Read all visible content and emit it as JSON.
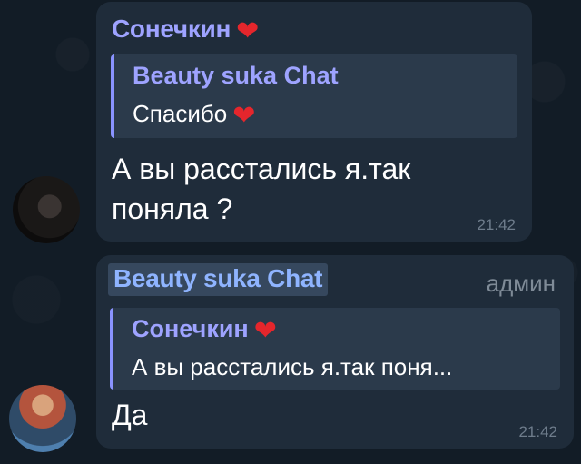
{
  "messages": [
    {
      "sender": "Сонечкин",
      "reply": {
        "author": "Beauty suka Chat",
        "text": "Спасибо"
      },
      "text": "А вы расстались я.так поняла ?",
      "time": "21:42"
    },
    {
      "sender": "Beauty suka Chat",
      "role": "админ",
      "reply": {
        "author": "Сонечкин",
        "text": "А вы расстались я.так поня..."
      },
      "text": "Да",
      "time": "21:42"
    }
  ],
  "icons": {
    "heart": "heart-emoji",
    "avatar1": "user-avatar",
    "avatar2": "user-avatar"
  },
  "colors": {
    "background": "#0e1621",
    "bubble": "#1f2c3a",
    "accent": "#9ea3ff",
    "heart": "#e5262c"
  }
}
